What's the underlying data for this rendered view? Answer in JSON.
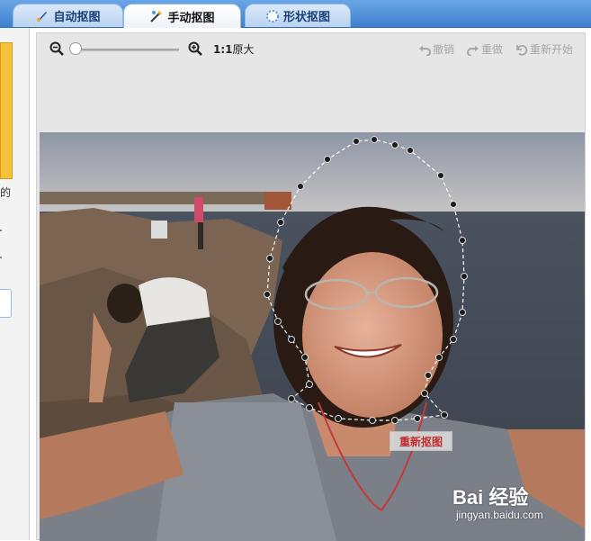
{
  "tabs": [
    {
      "label": "自动抠图",
      "icon": "auto-cutout-icon"
    },
    {
      "label": "手动抠图",
      "icon": "manual-cutout-icon",
      "active": true
    },
    {
      "label": "形状抠图",
      "icon": "shape-cutout-icon"
    }
  ],
  "left_panel": {
    "fragment_text": "的"
  },
  "toolbar": {
    "zoom_ratio": "1:1",
    "zoom_label": "原大",
    "undo_label": "撤销",
    "redo_label": "重做",
    "restart_label": "重新开始"
  },
  "canvas": {
    "redo_cut_label": "重新抠图"
  },
  "watermark": {
    "brand": "Bai 经验",
    "url": "jingyan.baidu.com"
  },
  "colors": {
    "tabbar": "#3f7fcf",
    "accent_red": "#c22c2c",
    "disabled_text": "#a6a6a6"
  }
}
